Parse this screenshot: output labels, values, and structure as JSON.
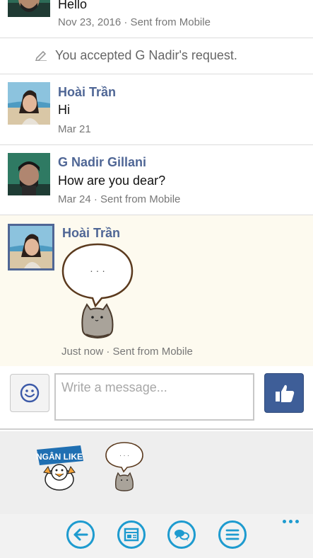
{
  "conversation": {
    "messages": [
      {
        "sender": "",
        "text": "Hello",
        "meta": "Nov 23, 2016 · Sent from Mobile"
      },
      {
        "system": "You accepted G Nadir's request."
      },
      {
        "sender": "Hoài Trần",
        "text": "Hi",
        "meta": "Mar 21"
      },
      {
        "sender": "G Nadir Gillani",
        "text": "How are you dear?",
        "meta": "Mar 24 · Sent from Mobile"
      },
      {
        "sender": "Hoài Trần",
        "sticker": "pusheen-speech-bubble-sticker",
        "sticker_text": "· · ·",
        "meta": "Just now · Sent from Mobile"
      }
    ]
  },
  "composer": {
    "placeholder": "Write a message...",
    "emoji_icon": "smiley-icon",
    "like_icon": "thumbs-up-icon"
  },
  "sticker_tray": {
    "stickers": [
      {
        "name": "ngan-like-sticker",
        "label": "NGÂN LIKE"
      },
      {
        "name": "pusheen-bubble-sticker",
        "label": "· · ·"
      }
    ]
  },
  "appbar": {
    "buttons": [
      "back-icon",
      "news-feed-icon",
      "chat-icon",
      "menu-icon"
    ],
    "more": "more-icon"
  },
  "colors": {
    "sender_name": "#4f6695",
    "accent_blue": "#1e9bcf",
    "like_button": "#3e5e98",
    "highlight_bg": "#fdfaef"
  }
}
